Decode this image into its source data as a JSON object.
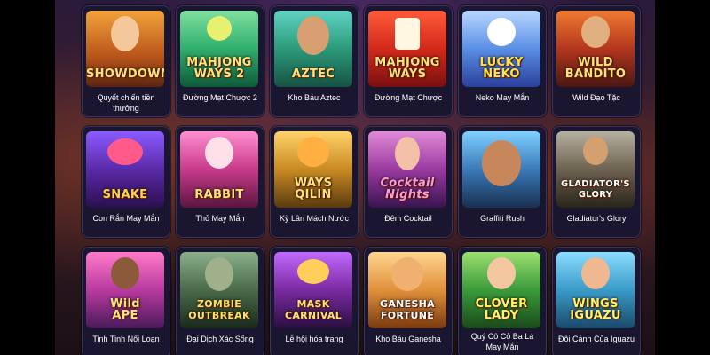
{
  "games": [
    {
      "label": "Quyết chiến tiền\nthưởng",
      "art_text": "SHOWDOWN",
      "art_icon": "cowgirl-icon"
    },
    {
      "label": "Đường Mạt Chược 2",
      "art_text": "MAHJONG\nWAYS 2",
      "art_icon": "dragon-icon"
    },
    {
      "label": "Kho Báu Aztec",
      "art_text": "AZTEC",
      "art_icon": "aztec-warrior-icon"
    },
    {
      "label": "Đường Mạt Chược",
      "art_text": "MAHJONG\nWAYS",
      "art_icon": "mahjong-tile-icon"
    },
    {
      "label": "Neko May Mắn",
      "art_text": "LUCKY\nNEKO",
      "art_icon": "lucky-cat-icon"
    },
    {
      "label": "Wild Đạo Tặc",
      "art_text": "WILD\nBANDITO",
      "art_icon": "bandit-icon"
    },
    {
      "label": "Con Rắn May Mắn",
      "art_text": "SNAKE",
      "art_icon": "snake-icon"
    },
    {
      "label": "Thỏ May Mắn",
      "art_text": "RABBIT",
      "art_icon": "rabbit-icon"
    },
    {
      "label": "Kỳ Lân Mách Nước",
      "art_text": "WAYS\nQILIN",
      "art_icon": "qilin-icon"
    },
    {
      "label": "Đêm Cocktail",
      "art_text": "Cocktail\nNights",
      "art_icon": "lady-icon"
    },
    {
      "label": "Graffiti Rush",
      "art_text": "",
      "art_icon": "boy-icon"
    },
    {
      "label": "Gladiator's Glory",
      "art_text": "GLADIATOR'S\nGLORY",
      "art_icon": "gladiator-icon"
    },
    {
      "label": "Tinh Tinh Nổi Loạn",
      "art_text": "Wild\nAPE",
      "art_icon": "ape-icon"
    },
    {
      "label": "Đại Dịch Xác Sống",
      "art_text": "ZOMBIE\nOUTBREAK",
      "art_icon": "zombie-icon"
    },
    {
      "label": "Lễ hội hóa trang",
      "art_text": "MASK\nCARNIVAL",
      "art_icon": "mask-icon"
    },
    {
      "label": "Kho Báu Ganesha",
      "art_text": "GANESHA\nFORTUNE",
      "art_icon": "ganesha-icon"
    },
    {
      "label": "Quý Cô Cỏ Ba Lá\nMay Mắn",
      "art_text": "CLOVER\nLADY",
      "art_icon": "clover-lady-icon"
    },
    {
      "label": "Đôi Cánh Của Iguazu",
      "art_text": "WINGS\nIGUAZU",
      "art_icon": "parrot-girl-icon"
    }
  ],
  "colors": {
    "card_bg": "#1a1630",
    "card_border": "#3a3560",
    "label_text": "#ffffff",
    "art_title": "#ffe27a"
  }
}
